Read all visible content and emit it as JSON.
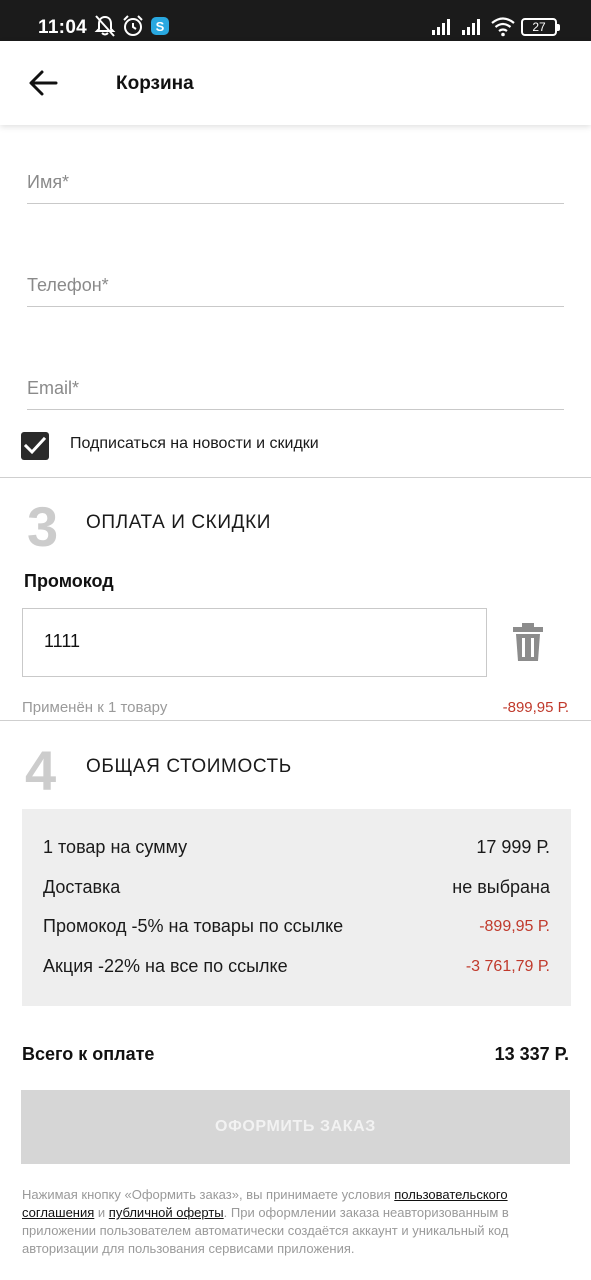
{
  "status_bar": {
    "time": "11:04",
    "battery": "27"
  },
  "header": {
    "title": "Корзина"
  },
  "contact_form": {
    "name_placeholder": "Имя*",
    "phone_placeholder": "Телефон*",
    "email_placeholder": "Email*",
    "subscribe_label": "Подписаться на новости и скидки",
    "subscribe_checked": true
  },
  "payment_section": {
    "number": "3",
    "title": "ОПЛАТА И СКИДКИ",
    "promo_label": "Промокод",
    "promo_value": "1111",
    "applied_text": "Применён к 1 товару",
    "applied_amount": "-899,95 Р."
  },
  "total_section": {
    "number": "4",
    "title": "ОБЩАЯ СТОИМОСТЬ",
    "rows": [
      {
        "label": "1 товар на сумму",
        "value": "17 999 Р."
      },
      {
        "label": "Доставка",
        "value": "не выбрана"
      },
      {
        "label": "Промокод -5% на товары по ссылке",
        "value": "-899,95 Р."
      },
      {
        "label": "Акция -22% на все по ссылке",
        "value": "-3 761,79 Р."
      }
    ],
    "total_label": "Всего к оплате",
    "total_value": "13 337 Р."
  },
  "order_button": {
    "label": "ОФОРМИТЬ ЗАКАЗ"
  },
  "legal": {
    "text_1": "Нажимая кнопку «Оформить заказ», вы принимаете условия ",
    "link_1": "пользовательского соглашения",
    "text_2": " и ",
    "link_2": "публичной оферты",
    "text_3": ". При оформлении заказа неавторизованным в приложении пользователем автоматически создаётся аккаунт и уникальный код авторизации для пользования сервисами приложения."
  },
  "colors": {
    "discount_red": "#c0392b",
    "button_disabled": "#d6d6d6",
    "summary_bg": "#eeeeee"
  },
  "icons": [
    "mute-icon",
    "alarm-icon",
    "skype-icon",
    "signal-icon",
    "wifi-icon",
    "battery-icon",
    "back-arrow-icon",
    "check-icon",
    "trash-icon"
  ]
}
